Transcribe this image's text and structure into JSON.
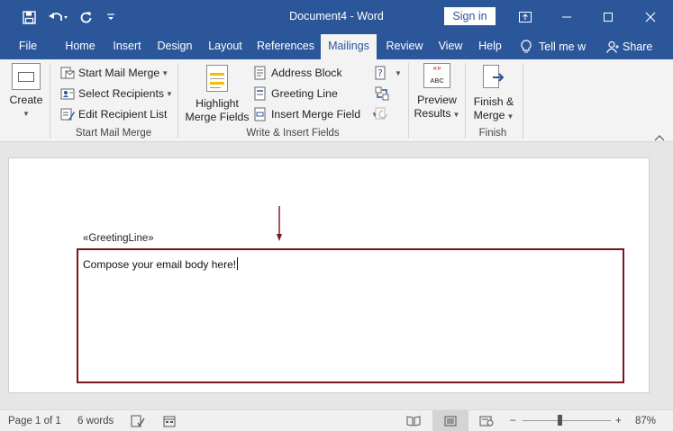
{
  "titlebar": {
    "title": "Document4  -  Word",
    "signin": "Sign in"
  },
  "tabs": [
    {
      "label": "File"
    },
    {
      "label": "Home"
    },
    {
      "label": "Insert"
    },
    {
      "label": "Design"
    },
    {
      "label": "Layout"
    },
    {
      "label": "References"
    },
    {
      "label": "Mailings"
    },
    {
      "label": "Review"
    },
    {
      "label": "View"
    },
    {
      "label": "Help"
    }
  ],
  "tellme": "Tell me w",
  "share": "Share",
  "ribbon": {
    "create": "Create",
    "start_mail_merge": "Start Mail Merge",
    "select_recipients": "Select Recipients",
    "edit_recipient_list": "Edit Recipient List",
    "group_start": "Start Mail Merge",
    "highlight_line1": "Highlight",
    "highlight_line2": "Merge Fields",
    "address_block": "Address Block",
    "greeting_line": "Greeting Line",
    "insert_merge_field": "Insert Merge Field",
    "group_write": "Write & Insert Fields",
    "preview_icon_text": "ABC",
    "preview_line1": "Preview",
    "preview_line2": "Results",
    "finish_line1": "Finish &",
    "finish_line2": "Merge",
    "group_finish": "Finish"
  },
  "document": {
    "greeting_field": "«GreetingLine»",
    "body": "Compose your email body here!"
  },
  "status": {
    "page": "Page 1 of 1",
    "words": "6 words",
    "zoom": "87%",
    "zoom_minus": "−",
    "zoom_plus": "+"
  }
}
